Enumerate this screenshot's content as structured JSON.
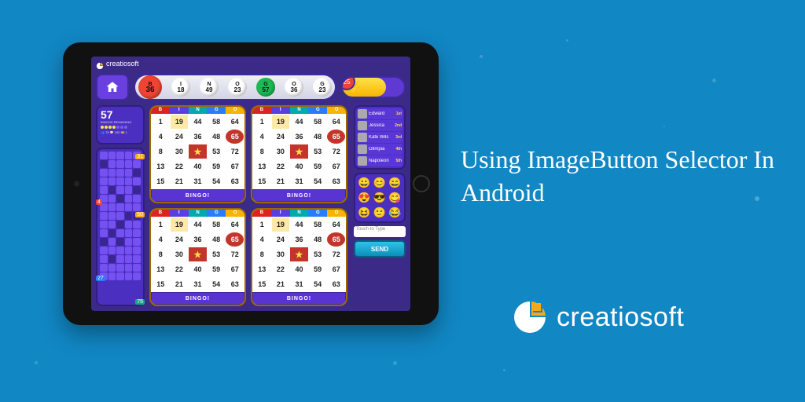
{
  "headline": "Using ImageButton Selector In Android",
  "brand_name": "creatiosoft",
  "tablet_brand": "creatiosoft",
  "meter": {
    "badge": "25"
  },
  "balls": [
    {
      "letter": "B",
      "num": "36",
      "color": "#e43",
      "big": true
    },
    {
      "letter": "I",
      "num": "18",
      "color": "#fff"
    },
    {
      "letter": "N",
      "num": "49",
      "color": "#fff"
    },
    {
      "letter": "O",
      "num": "23",
      "color": "#fff"
    },
    {
      "letter": "G",
      "num": "57",
      "color": "#1db954"
    },
    {
      "letter": "O",
      "num": "36",
      "color": "#fff"
    },
    {
      "letter": "G",
      "num": "23",
      "color": "#fff"
    }
  ],
  "stats": {
    "big_number": "57",
    "caption": "BINGOS REMAINING",
    "footer": "👥 75  💬 100  🎫 1"
  },
  "cards_header": [
    "B",
    "I",
    "N",
    "G",
    "O"
  ],
  "card_numbers": [
    [
      "1",
      "19",
      "44",
      "58",
      "64",
      "4",
      "24",
      "36",
      "48",
      "65",
      "8",
      "30",
      "★",
      "53",
      "72",
      "13",
      "22",
      "40",
      "59",
      "67",
      "15",
      "21",
      "31",
      "54",
      "63"
    ],
    [
      "1",
      "19",
      "44",
      "58",
      "64",
      "4",
      "24",
      "36",
      "48",
      "65",
      "8",
      "30",
      "★",
      "53",
      "72",
      "13",
      "22",
      "40",
      "59",
      "67",
      "15",
      "21",
      "31",
      "54",
      "63"
    ],
    [
      "1",
      "19",
      "44",
      "58",
      "64",
      "4",
      "24",
      "36",
      "48",
      "65",
      "8",
      "30",
      "★",
      "53",
      "72",
      "13",
      "22",
      "40",
      "59",
      "67",
      "15",
      "21",
      "31",
      "54",
      "63"
    ],
    [
      "1",
      "19",
      "44",
      "58",
      "64",
      "4",
      "24",
      "36",
      "48",
      "65",
      "8",
      "30",
      "★",
      "53",
      "72",
      "13",
      "22",
      "40",
      "59",
      "67",
      "15",
      "21",
      "31",
      "54",
      "63"
    ]
  ],
  "bingo_button_label": "BINGO!",
  "leaderboard": [
    {
      "name": "Edward",
      "rank": "1st"
    },
    {
      "name": "Jessica",
      "rank": "2nd"
    },
    {
      "name": "Kate Wils",
      "rank": "3rd"
    },
    {
      "name": "Olimpia",
      "rank": "4th"
    },
    {
      "name": "Napoleon",
      "rank": "5th"
    }
  ],
  "emojis": [
    "😀",
    "😊",
    "😄",
    "😍",
    "😎",
    "😋",
    "😆",
    "🙂",
    "😂"
  ],
  "chat_placeholder": "Touch to Type",
  "send_label": "SEND",
  "board_flags": {
    "a": "31",
    "b": "4",
    "c": "50",
    "d": "27",
    "e": "75"
  }
}
